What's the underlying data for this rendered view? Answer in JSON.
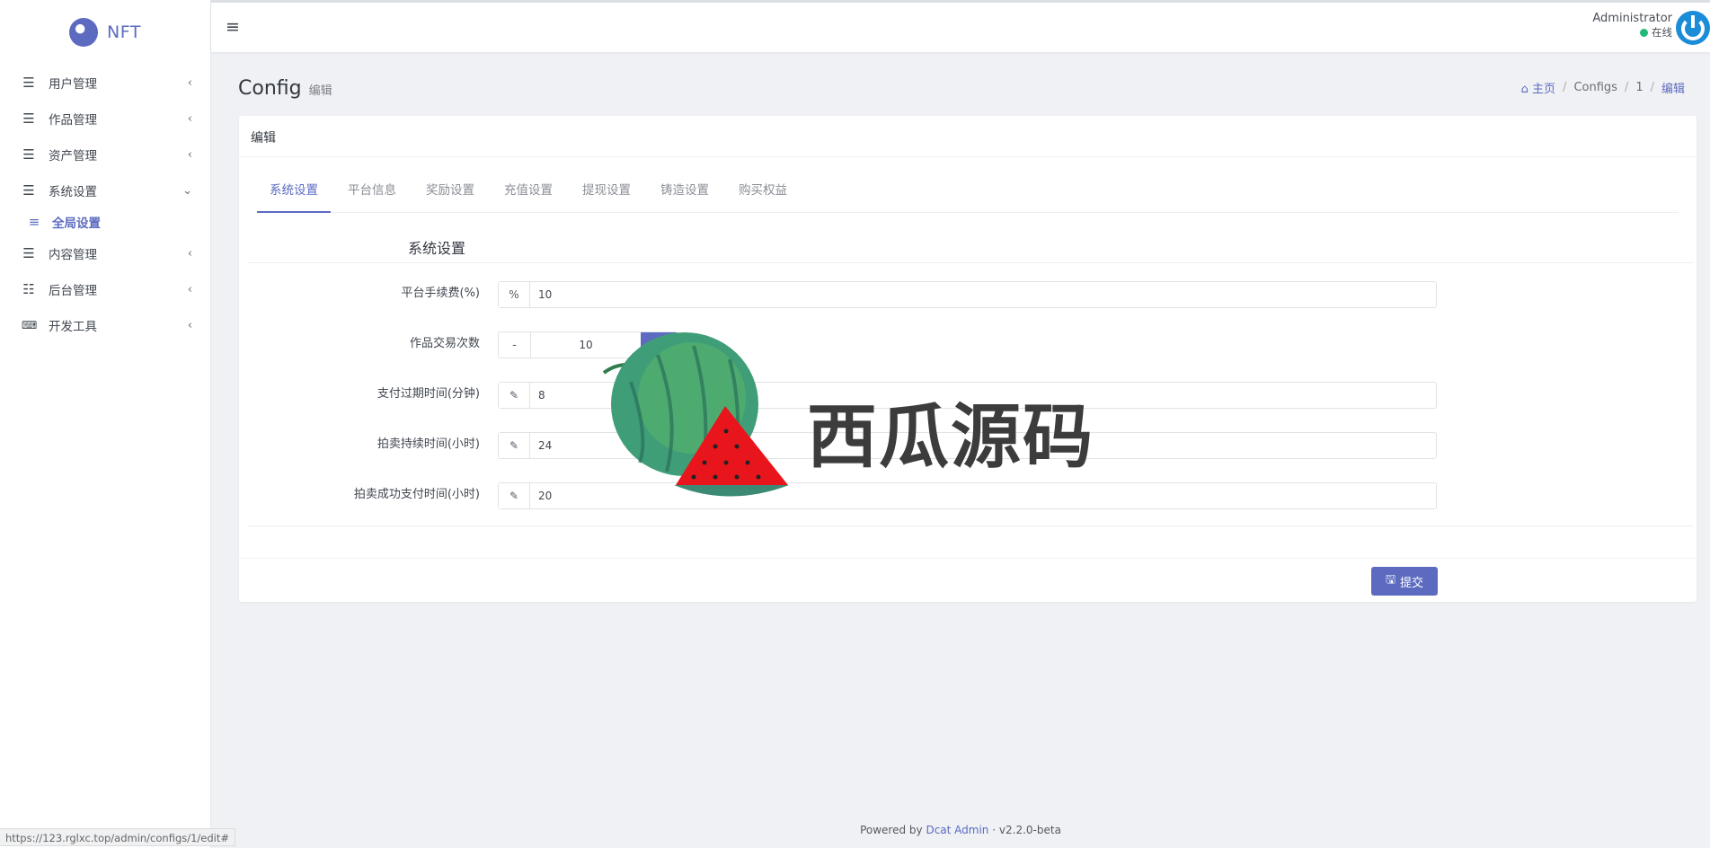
{
  "brand": {
    "name": "NFT"
  },
  "sidebar": {
    "items": [
      {
        "label": "用户管理",
        "icon": "list-icon",
        "chevron": "‹"
      },
      {
        "label": "作品管理",
        "icon": "list-icon",
        "chevron": "‹"
      },
      {
        "label": "资产管理",
        "icon": "list-icon",
        "chevron": "‹"
      },
      {
        "label": "系统设置",
        "icon": "list-icon",
        "chevron": "⌄",
        "expanded": true
      },
      {
        "label": "内容管理",
        "icon": "list-icon",
        "chevron": "‹"
      },
      {
        "label": "后台管理",
        "icon": "tasks-icon",
        "chevron": "‹"
      },
      {
        "label": "开发工具",
        "icon": "keyboard-icon",
        "chevron": "‹"
      }
    ],
    "sub_item": {
      "label": "全局设置",
      "icon": "list-icon"
    }
  },
  "topbar": {
    "user_name": "Administrator",
    "status_text": "在线"
  },
  "header": {
    "title": "Config",
    "subtitle": "编辑"
  },
  "breadcrumb": {
    "home": "主页",
    "items": [
      "Configs",
      "1",
      "编辑"
    ]
  },
  "card": {
    "header": "编辑",
    "tabs": [
      "系统设置",
      "平台信息",
      "奖励设置",
      "充值设置",
      "提现设置",
      "铸造设置",
      "购买权益"
    ],
    "active_tab": "系统设置",
    "section_title": "系统设置",
    "fields": [
      {
        "label": "平台手续费(%)",
        "addon": "%",
        "value": "10"
      },
      {
        "label": "作品交易次数",
        "addon": "-",
        "value": "10"
      },
      {
        "label": "支付过期时间(分钟)",
        "addon": "pencil-icon",
        "value": "8"
      },
      {
        "label": "拍卖持续时间(小时)",
        "addon": "pencil-icon",
        "value": "24"
      },
      {
        "label": "拍卖成功支付时间(小时)",
        "addon": "pencil-icon",
        "value": "20"
      }
    ],
    "submit_label": "提交"
  },
  "watermark": {
    "text": "西瓜源码"
  },
  "footer": {
    "prefix": "Powered by",
    "link": "Dcat Admin",
    "sep": "·",
    "version": "v2.2.0-beta"
  },
  "status_url": "https://123.rglxc.top/admin/configs/1/edit#",
  "colors": {
    "accent": "#5c6bc0",
    "online": "#21b978"
  }
}
